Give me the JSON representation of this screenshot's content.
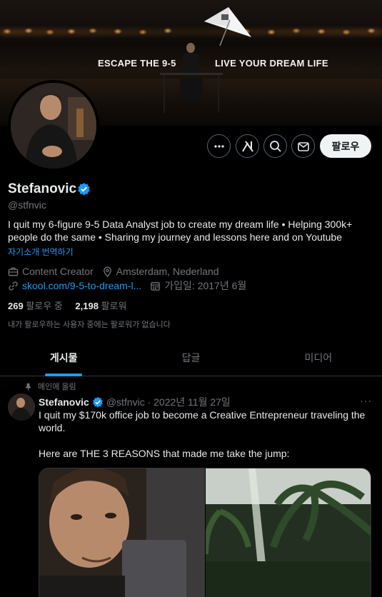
{
  "banner": {
    "left_text": "ESCAPE THE 9-5",
    "right_text": "LIVE YOUR DREAM LIFE"
  },
  "actions": {
    "more_icon": "ellipsis-icon",
    "grok_icon": "grok-icon",
    "search_icon": "search-icon",
    "message_icon": "envelope-icon",
    "follow_label": "팔로우"
  },
  "profile": {
    "name": "Stefanovic",
    "handle": "@stfnvic",
    "bio": "I quit my 6-figure 9-5 Data Analyst job to create my dream life • Helping 300k+ people do the same • Sharing my journey and lessons here and on Youtube",
    "translate_label": "자기소개 번역하기",
    "category": "Content Creator",
    "location": "Amsterdam, Nederland",
    "link": "skool.com/9-5-to-dream-l...",
    "joined": "가입일: 2017년 6월",
    "following_count": "269",
    "following_label": "팔로우 중",
    "followers_count": "2,198",
    "followers_label": "팔로워",
    "no_mutual": "내가 팔로우하는 사용자 중에는 팔로워가 없습니다"
  },
  "tabs": [
    {
      "label": "게시물",
      "active": true
    },
    {
      "label": "답글",
      "active": false
    },
    {
      "label": "미디어",
      "active": false
    }
  ],
  "tweet": {
    "pinned_label": "메인에 올림",
    "author": "Stefanovic",
    "handle_date": "@stfnvic · 2022년 11월 27일",
    "more": "···",
    "text": "I quit my $170k office job to become a Creative Entrepreneur traveling the world.\n\nHere are THE 3 REASONS that made me take the jump:"
  },
  "colors": {
    "accent": "#1d9bf0",
    "background": "#000000",
    "text_primary": "#e7e9ea",
    "text_secondary": "#71767b",
    "border": "#2f3336"
  }
}
